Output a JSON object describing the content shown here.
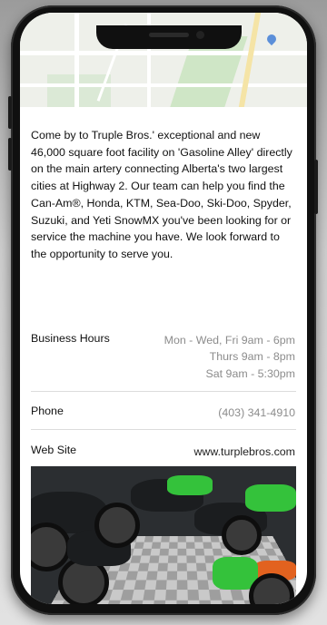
{
  "description": "Come by to Truple Bros.' exceptional and new 46,000 square foot facility on 'Gasoline Alley' directly on the main artery connecting Alberta's two largest cities at Highway 2. Our team can help you find the Can-Am®, Honda, KTM, Sea-Doo, Ski-Doo, Spyder, Suzuki, and Yeti SnowMX you've been looking for or service the machine you have. We look forward to the opportunity to serve you.",
  "business_hours": {
    "label": "Business Hours",
    "lines": [
      "Mon - Wed, Fri 9am - 6pm",
      "Thurs 9am - 8pm",
      "Sat 9am - 5:30pm"
    ]
  },
  "phone": {
    "label": "Phone",
    "value": "(403) 341-4910"
  },
  "website": {
    "label": "Web Site",
    "value": "www.turplebros.com"
  },
  "icons": {
    "map_pin": "map-pin-icon"
  }
}
